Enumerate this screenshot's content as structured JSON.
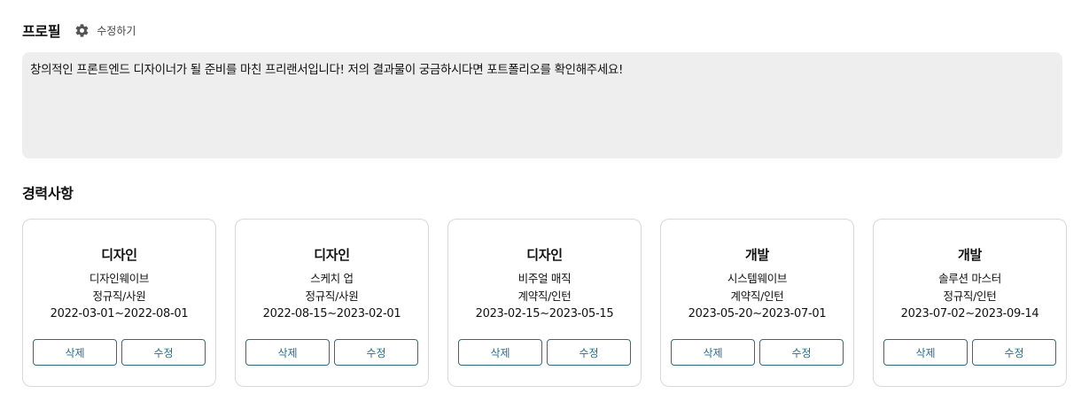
{
  "profile": {
    "title": "프로필",
    "edit_label": "수정하기",
    "intro": "창의적인 프론트엔드 디자이너가 될 준비를 마친 프리랜서입니다! 저의 결과물이 궁금하시다면 포트폴리오를 확인해주세요!"
  },
  "career": {
    "title": "경력사항",
    "cards": [
      {
        "category": "디자인",
        "company": "디자인웨이브",
        "type": "정규직/사원",
        "period": "2022-03-01~2022-08-01",
        "delete_label": "삭제",
        "edit_label": "수정"
      },
      {
        "category": "디자인",
        "company": "스케치 업",
        "type": "정규직/사원",
        "period": "2022-08-15~2023-02-01",
        "delete_label": "삭제",
        "edit_label": "수정"
      },
      {
        "category": "디자인",
        "company": "비주얼 매직",
        "type": "계약직/인턴",
        "period": "2023-02-15~2023-05-15",
        "delete_label": "삭제",
        "edit_label": "수정"
      },
      {
        "category": "개발",
        "company": "시스템웨이브",
        "type": "계약직/인턴",
        "period": "2023-05-20~2023-07-01",
        "delete_label": "삭제",
        "edit_label": "수정"
      },
      {
        "category": "개발",
        "company": "솔루션 마스터",
        "type": "정규직/인턴",
        "period": "2023-07-02~2023-09-14",
        "delete_label": "삭제",
        "edit_label": "수정"
      }
    ]
  },
  "colors": {
    "accent": "#1f6f99",
    "intro_background": "#eeeeee",
    "card_border": "#d9d9d9"
  },
  "icons": {
    "edit": "gear-icon"
  }
}
